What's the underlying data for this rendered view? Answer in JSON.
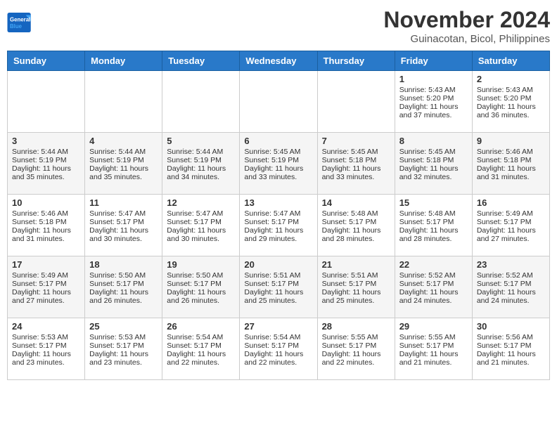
{
  "logo": {
    "line1": "General",
    "line2": "Blue"
  },
  "title": "November 2024",
  "subtitle": "Guinacotan, Bicol, Philippines",
  "weekdays": [
    "Sunday",
    "Monday",
    "Tuesday",
    "Wednesday",
    "Thursday",
    "Friday",
    "Saturday"
  ],
  "weeks": [
    [
      {
        "day": "",
        "info": ""
      },
      {
        "day": "",
        "info": ""
      },
      {
        "day": "",
        "info": ""
      },
      {
        "day": "",
        "info": ""
      },
      {
        "day": "",
        "info": ""
      },
      {
        "day": "1",
        "info": "Sunrise: 5:43 AM\nSunset: 5:20 PM\nDaylight: 11 hours and 37 minutes."
      },
      {
        "day": "2",
        "info": "Sunrise: 5:43 AM\nSunset: 5:20 PM\nDaylight: 11 hours and 36 minutes."
      }
    ],
    [
      {
        "day": "3",
        "info": "Sunrise: 5:44 AM\nSunset: 5:19 PM\nDaylight: 11 hours and 35 minutes."
      },
      {
        "day": "4",
        "info": "Sunrise: 5:44 AM\nSunset: 5:19 PM\nDaylight: 11 hours and 35 minutes."
      },
      {
        "day": "5",
        "info": "Sunrise: 5:44 AM\nSunset: 5:19 PM\nDaylight: 11 hours and 34 minutes."
      },
      {
        "day": "6",
        "info": "Sunrise: 5:45 AM\nSunset: 5:19 PM\nDaylight: 11 hours and 33 minutes."
      },
      {
        "day": "7",
        "info": "Sunrise: 5:45 AM\nSunset: 5:18 PM\nDaylight: 11 hours and 33 minutes."
      },
      {
        "day": "8",
        "info": "Sunrise: 5:45 AM\nSunset: 5:18 PM\nDaylight: 11 hours and 32 minutes."
      },
      {
        "day": "9",
        "info": "Sunrise: 5:46 AM\nSunset: 5:18 PM\nDaylight: 11 hours and 31 minutes."
      }
    ],
    [
      {
        "day": "10",
        "info": "Sunrise: 5:46 AM\nSunset: 5:18 PM\nDaylight: 11 hours and 31 minutes."
      },
      {
        "day": "11",
        "info": "Sunrise: 5:47 AM\nSunset: 5:17 PM\nDaylight: 11 hours and 30 minutes."
      },
      {
        "day": "12",
        "info": "Sunrise: 5:47 AM\nSunset: 5:17 PM\nDaylight: 11 hours and 30 minutes."
      },
      {
        "day": "13",
        "info": "Sunrise: 5:47 AM\nSunset: 5:17 PM\nDaylight: 11 hours and 29 minutes."
      },
      {
        "day": "14",
        "info": "Sunrise: 5:48 AM\nSunset: 5:17 PM\nDaylight: 11 hours and 28 minutes."
      },
      {
        "day": "15",
        "info": "Sunrise: 5:48 AM\nSunset: 5:17 PM\nDaylight: 11 hours and 28 minutes."
      },
      {
        "day": "16",
        "info": "Sunrise: 5:49 AM\nSunset: 5:17 PM\nDaylight: 11 hours and 27 minutes."
      }
    ],
    [
      {
        "day": "17",
        "info": "Sunrise: 5:49 AM\nSunset: 5:17 PM\nDaylight: 11 hours and 27 minutes."
      },
      {
        "day": "18",
        "info": "Sunrise: 5:50 AM\nSunset: 5:17 PM\nDaylight: 11 hours and 26 minutes."
      },
      {
        "day": "19",
        "info": "Sunrise: 5:50 AM\nSunset: 5:17 PM\nDaylight: 11 hours and 26 minutes."
      },
      {
        "day": "20",
        "info": "Sunrise: 5:51 AM\nSunset: 5:17 PM\nDaylight: 11 hours and 25 minutes."
      },
      {
        "day": "21",
        "info": "Sunrise: 5:51 AM\nSunset: 5:17 PM\nDaylight: 11 hours and 25 minutes."
      },
      {
        "day": "22",
        "info": "Sunrise: 5:52 AM\nSunset: 5:17 PM\nDaylight: 11 hours and 24 minutes."
      },
      {
        "day": "23",
        "info": "Sunrise: 5:52 AM\nSunset: 5:17 PM\nDaylight: 11 hours and 24 minutes."
      }
    ],
    [
      {
        "day": "24",
        "info": "Sunrise: 5:53 AM\nSunset: 5:17 PM\nDaylight: 11 hours and 23 minutes."
      },
      {
        "day": "25",
        "info": "Sunrise: 5:53 AM\nSunset: 5:17 PM\nDaylight: 11 hours and 23 minutes."
      },
      {
        "day": "26",
        "info": "Sunrise: 5:54 AM\nSunset: 5:17 PM\nDaylight: 11 hours and 22 minutes."
      },
      {
        "day": "27",
        "info": "Sunrise: 5:54 AM\nSunset: 5:17 PM\nDaylight: 11 hours and 22 minutes."
      },
      {
        "day": "28",
        "info": "Sunrise: 5:55 AM\nSunset: 5:17 PM\nDaylight: 11 hours and 22 minutes."
      },
      {
        "day": "29",
        "info": "Sunrise: 5:55 AM\nSunset: 5:17 PM\nDaylight: 11 hours and 21 minutes."
      },
      {
        "day": "30",
        "info": "Sunrise: 5:56 AM\nSunset: 5:17 PM\nDaylight: 11 hours and 21 minutes."
      }
    ]
  ]
}
